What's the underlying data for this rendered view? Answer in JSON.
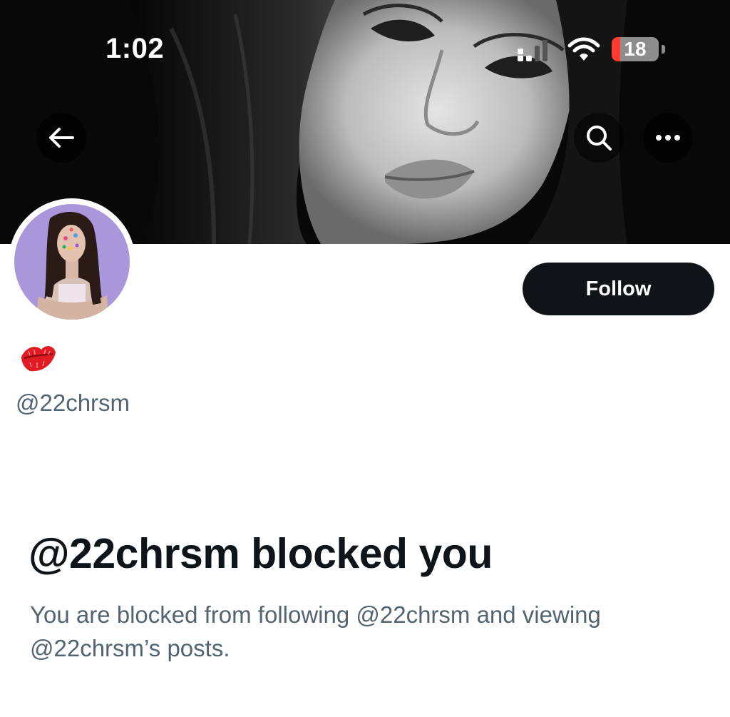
{
  "status_bar": {
    "time": "1:02",
    "battery_level": "18",
    "battery_fraction": 0.18,
    "icons": [
      "cellular-signal-icon",
      "wifi-icon",
      "battery-icon"
    ]
  },
  "header": {
    "back_icon": "arrow-left-icon",
    "search_icon": "search-icon",
    "more_icon": "more-horizontal-icon"
  },
  "profile": {
    "display_name_emoji": "💋",
    "handle": "@22chrsm",
    "follow_label": "Follow"
  },
  "blocked_notice": {
    "title": "@22chrsm blocked you",
    "description": "You are blocked from following @22chrsm and viewing @22chrsm’s posts."
  },
  "colors": {
    "primary_text": "#0f1419",
    "secondary_text": "#536471",
    "follow_button_bg": "#0f1419",
    "battery_low": "#ff3b30"
  }
}
